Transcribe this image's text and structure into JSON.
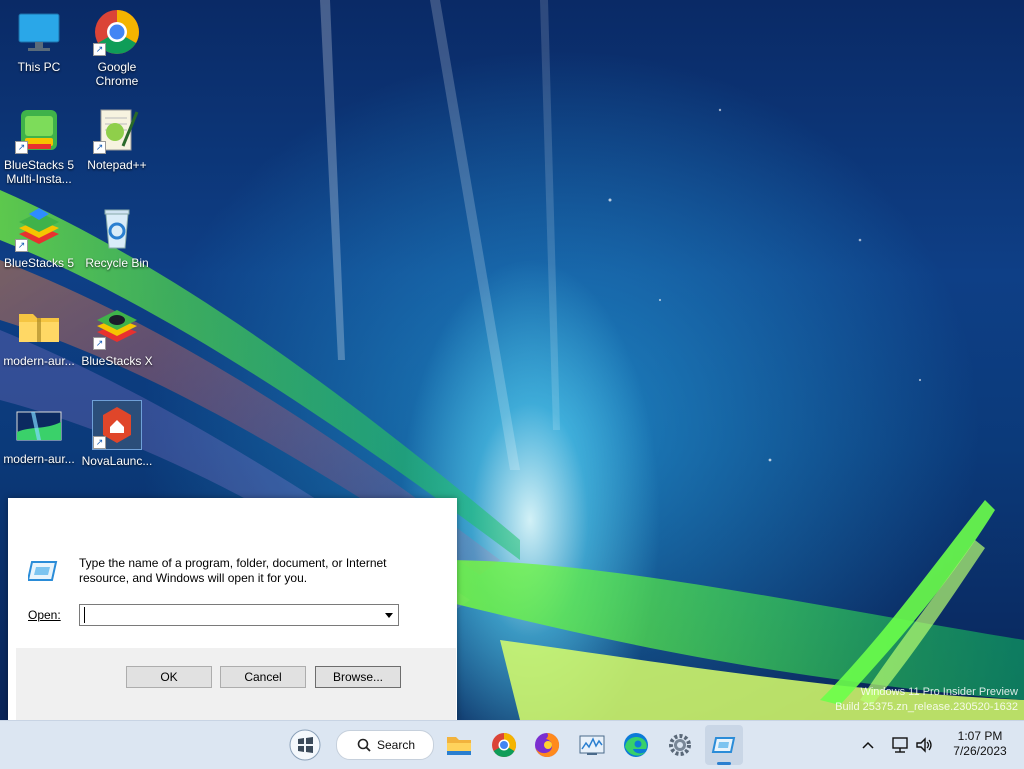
{
  "desktop": {
    "icons": [
      {
        "label": "This PC",
        "icon": "monitor-icon"
      },
      {
        "label": "Google\nChrome",
        "icon": "chrome-icon"
      },
      {
        "label": "BlueStacks 5\nMulti-Insta...",
        "icon": "bluestacks-multi-icon"
      },
      {
        "label": "Notepad++",
        "icon": "notepadpp-icon"
      },
      {
        "label": "BlueStacks 5",
        "icon": "bluestacks-icon"
      },
      {
        "label": "Recycle Bin",
        "icon": "recycle-bin-icon"
      },
      {
        "label": "modern-aur...",
        "icon": "zip-folder-icon"
      },
      {
        "label": "BlueStacks X",
        "icon": "bluestacks-x-icon"
      },
      {
        "label": "modern-aur...",
        "icon": "image-file-icon"
      },
      {
        "label": "NovaLaunc...",
        "icon": "nova-launcher-icon"
      }
    ],
    "watermark_line1": "Windows 11 Pro Insider Preview",
    "watermark_line2": "Build 25375.zn_release.230520-1632"
  },
  "run_dialog": {
    "description": "Type the name of a program, folder, document, or Internet resource, and Windows will open it for you.",
    "open_label": "Open:",
    "open_value": "",
    "ok_label": "OK",
    "cancel_label": "Cancel",
    "browse_label": "Browse..."
  },
  "taskbar": {
    "search_label": "Search",
    "time": "1:07 PM",
    "date": "7/26/2023"
  },
  "colors": {
    "taskbar_bg": "#dce6f2",
    "dialog_footer": "#f0f0f0",
    "button_bg": "#e1e1e1"
  }
}
